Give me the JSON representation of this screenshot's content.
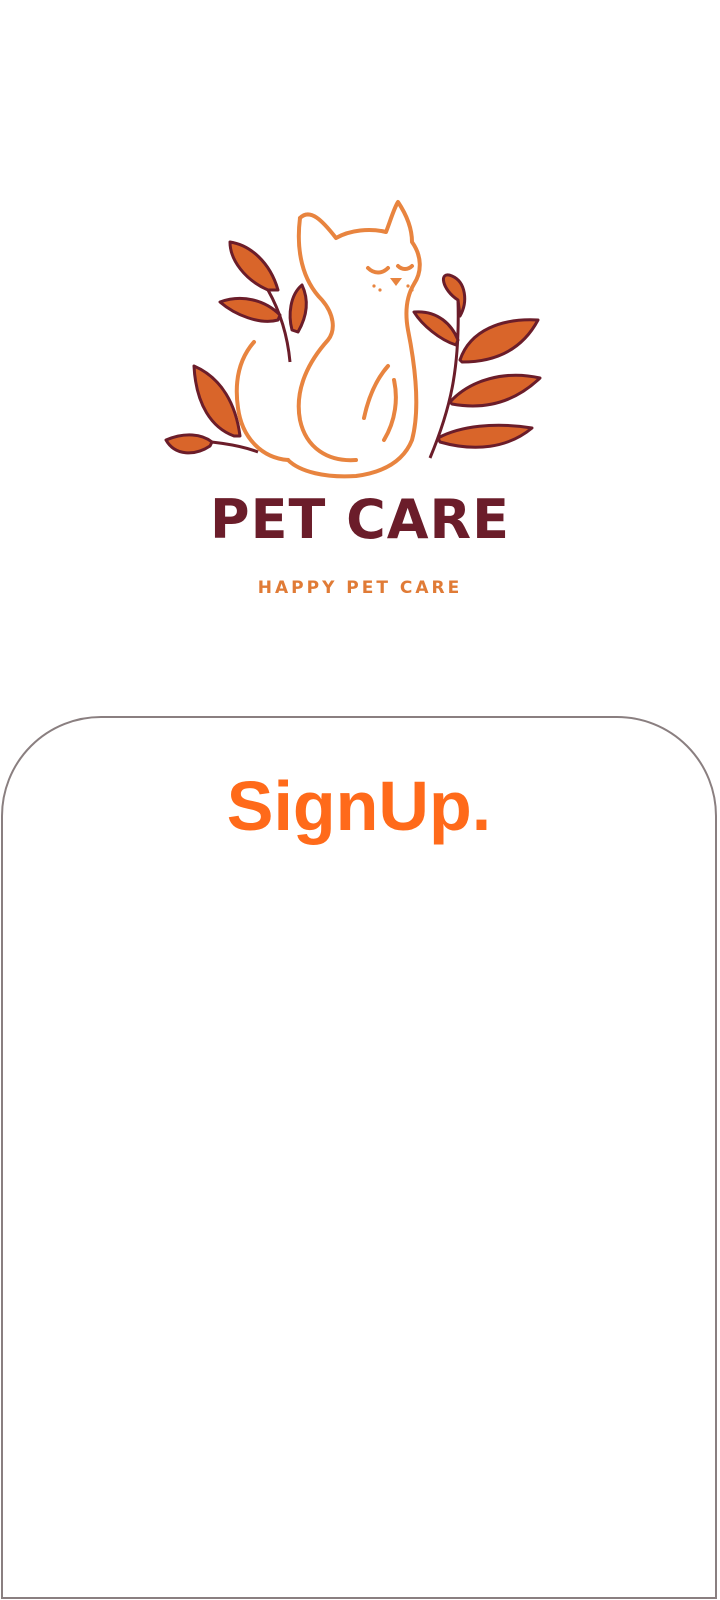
{
  "logo": {
    "title": "PET CARE",
    "subtitle": "HAPPY PET CARE",
    "icon": "cat-with-leaves-icon",
    "colors": {
      "cat": "#e8843f",
      "leaf_fill": "#d9652a",
      "leaf_stroke": "#6b1d2a",
      "title": "#6b1d2a",
      "subtitle": "#e07b36"
    }
  },
  "signup": {
    "title": "SignUp.",
    "title_color": "#ff6a1a",
    "border_color": "#8a7f80"
  }
}
